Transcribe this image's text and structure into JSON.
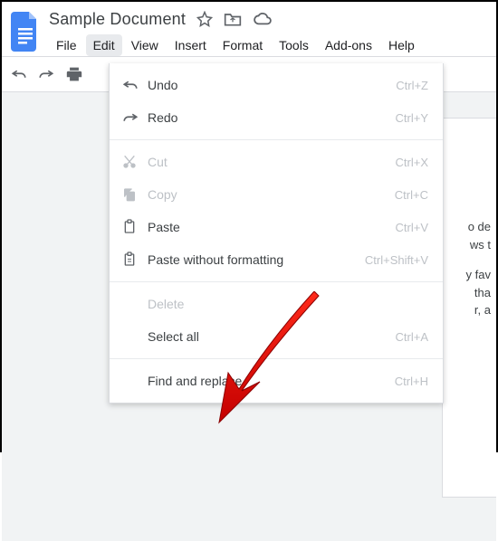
{
  "header": {
    "title": "Sample Document"
  },
  "menubar": {
    "items": [
      "File",
      "Edit",
      "View",
      "Insert",
      "Format",
      "Tools",
      "Add-ons",
      "Help"
    ],
    "active_index": 1
  },
  "dropdown": {
    "items": [
      {
        "id": "undo",
        "icon": "undo-icon",
        "label": "Undo",
        "shortcut": "Ctrl+Z",
        "disabled": false
      },
      {
        "id": "redo",
        "icon": "redo-icon",
        "label": "Redo",
        "shortcut": "Ctrl+Y",
        "disabled": false
      },
      {
        "sep": true
      },
      {
        "id": "cut",
        "icon": "cut-icon",
        "label": "Cut",
        "shortcut": "Ctrl+X",
        "disabled": true
      },
      {
        "id": "copy",
        "icon": "copy-icon",
        "label": "Copy",
        "shortcut": "Ctrl+C",
        "disabled": true
      },
      {
        "id": "paste",
        "icon": "paste-icon",
        "label": "Paste",
        "shortcut": "Ctrl+V",
        "disabled": false
      },
      {
        "id": "paste-no-format",
        "icon": "paste-plain-icon",
        "label": "Paste without formatting",
        "shortcut": "Ctrl+Shift+V",
        "disabled": false
      },
      {
        "sep": true
      },
      {
        "id": "delete",
        "icon": "",
        "label": "Delete",
        "shortcut": "",
        "disabled": true
      },
      {
        "id": "select-all",
        "icon": "",
        "label": "Select all",
        "shortcut": "Ctrl+A",
        "disabled": false
      },
      {
        "sep": true
      },
      {
        "id": "find-replace",
        "icon": "",
        "label": "Find and replace",
        "shortcut": "Ctrl+H",
        "disabled": false
      }
    ]
  },
  "page_text": {
    "p1": "o de\nws t",
    "p2": "y fav\n tha\nr, a"
  }
}
